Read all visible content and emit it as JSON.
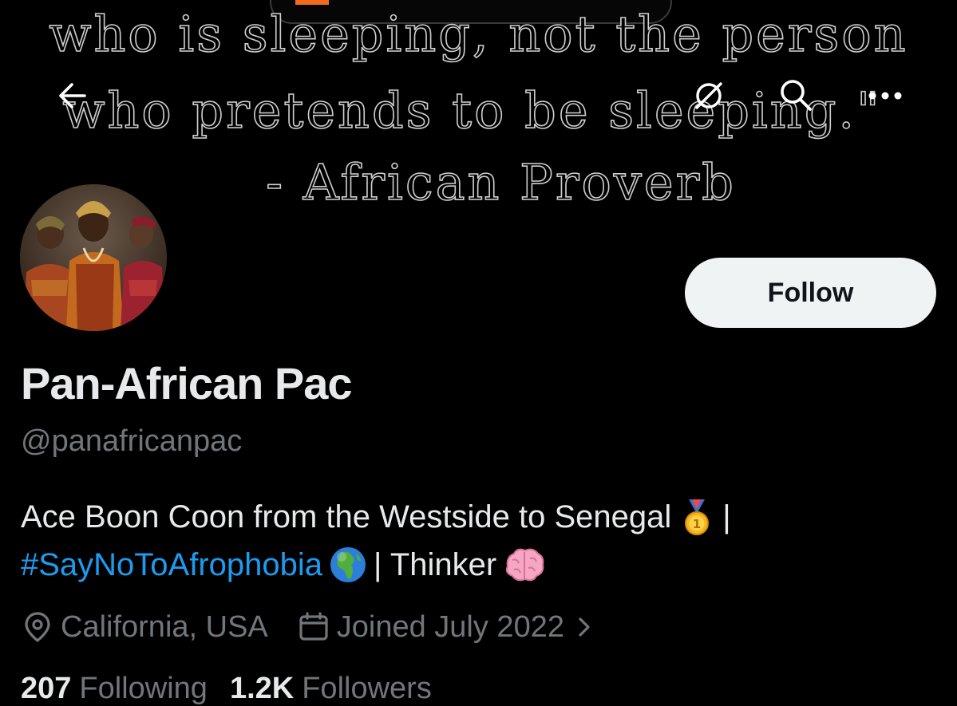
{
  "banner": {
    "quote_line1": "who is sleeping, not the person",
    "quote_line2": "who pretends to be sleeping.\"",
    "quote_line3": "- African Proverb"
  },
  "nav": {
    "back_icon": "arrow-left-icon",
    "mute_icon": "mute-icon",
    "search_icon": "search-icon",
    "more_icon": "more-horizontal-icon"
  },
  "profile": {
    "display_name": "Pan-African Pac",
    "handle": "@panafricanpac",
    "follow_label": "Follow",
    "bio": {
      "line1_text": "Ace Boon Coon from the Westside to Senegal",
      "line1_emoji": "1st-place-medal-emoji",
      "line1_sep": "|",
      "hashtag": "#SayNoToAfrophobia",
      "line2_emoji_globe": "globe-africa-emoji",
      "line2_text": "| Thinker",
      "line2_emoji_brain": "brain-emoji"
    },
    "location": "California, USA",
    "joined": "Joined July 2022",
    "following_count": "207",
    "following_label": "Following",
    "followers_count": "1.2K",
    "followers_label": "Followers"
  },
  "colors": {
    "background": "#000000",
    "text_primary": "#e7e9ea",
    "text_secondary": "#71767b",
    "link": "#1d9bf0",
    "follow_bg": "#eff3f4"
  }
}
